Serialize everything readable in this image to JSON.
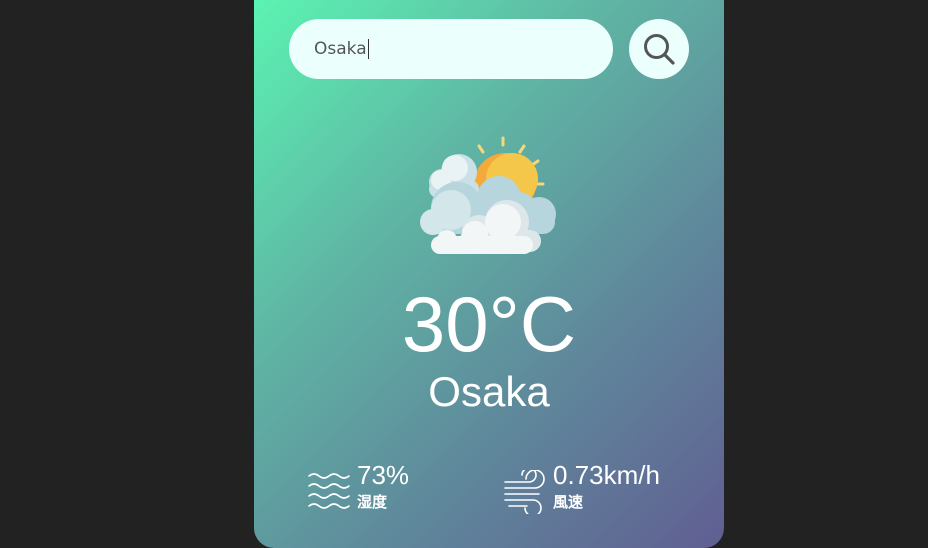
{
  "search": {
    "value": "Osaka"
  },
  "weather": {
    "condition_icon": "partly-cloudy-sun-icon",
    "temperature": "30°C",
    "city": "Osaka"
  },
  "details": {
    "humidity": {
      "icon": "humidity-waves-icon",
      "value": "73%",
      "label": "湿度"
    },
    "wind": {
      "icon": "wind-icon",
      "value": "0.73km/h",
      "label": "風速"
    }
  },
  "colors": {
    "page_background": "#222222",
    "card_gradient_start": "#5bf7b3",
    "card_gradient_end": "#605e92",
    "input_background": "#ebfffc",
    "text": "#ffffff"
  }
}
